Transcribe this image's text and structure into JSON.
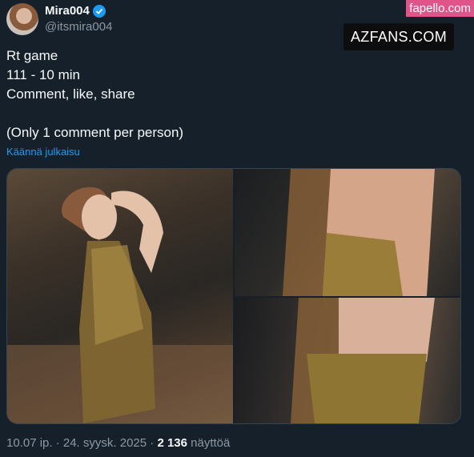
{
  "tweet": {
    "display_name": "Mira004",
    "handle": "@itsmira004",
    "verified_icon": "verified-badge-icon",
    "text_lines": [
      "Rt game",
      "111 - 10 min",
      "Comment, like, share",
      "",
      "(Only 1 comment per person)"
    ],
    "translate_label": "Käännä julkaisu",
    "timestamp": "10.07 ip. · 24. syysk. 2025 · ",
    "view_count": "2 136",
    "views_label": " näyttöä"
  },
  "watermarks": {
    "fapello": "fapello.com",
    "azfans": "AZFANS.COM"
  },
  "colors": {
    "background": "#15202b",
    "accent": "#1d9bf0",
    "secondary_text": "#8b98a5"
  }
}
